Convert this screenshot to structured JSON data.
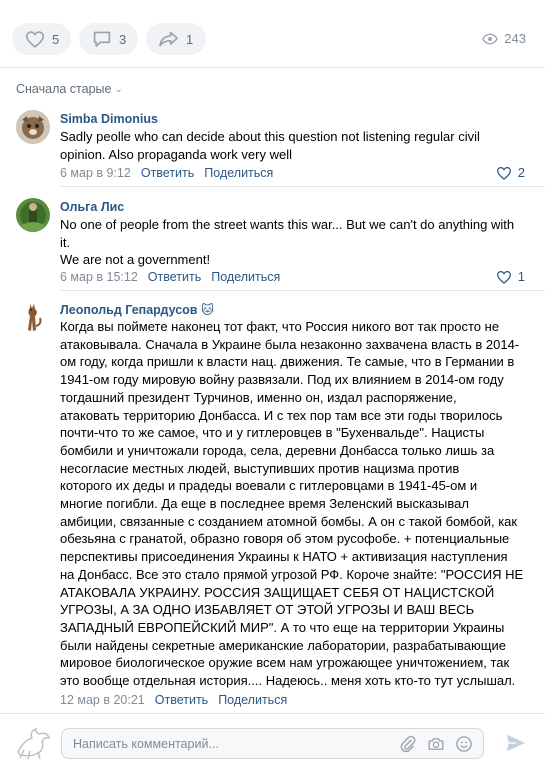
{
  "post_actions": {
    "likes": "5",
    "comments": "3",
    "shares": "1",
    "views": "243",
    "icons": {
      "like": "heart-icon",
      "comment": "comment-icon",
      "share": "share-icon",
      "views": "eye-icon"
    }
  },
  "sort": {
    "label": "Сначала старые",
    "icon": "chevron-down-icon"
  },
  "comments": [
    {
      "author": "Simba Dimonius",
      "lines": [
        "Sadly peolle who can decide about this question not listening regular civil",
        "opinion. Also propaganda work very well"
      ],
      "date": "6 мар в 9:12",
      "reply": "Ответить",
      "share": "Поделиться",
      "likes": "2"
    },
    {
      "author": "Ольга Лис",
      "lines": [
        "No one of people from the street wants this war... But we can't do anything with",
        "it.",
        "We are not a government!"
      ],
      "date": "6 мар в 15:12",
      "reply": "Ответить",
      "share": "Поделиться",
      "likes": "1"
    },
    {
      "author": "Леопольд Гепардусов",
      "badge": "🐱",
      "lines": [
        "Когда вы поймете наконец тот факт, что Россия никого вот так просто не",
        "атаковывала. Сначала в Украине была незаконно захвачена власть в 2014-",
        "ом году, когда пришли к власти нац. движения. Те самые, что в Германии в",
        "1941-ом году мировую войну развязали. Под их влиянием в 2014-ом году",
        "тогдашний президент Турчинов, именно он, издал распоряжение,",
        "атаковать территорию Донбасса. И с тех пор там все эти годы творилось",
        "почти-что то же самое, что и у гитлеровцев в \"Бухенвальде\". Нацисты",
        "бомбили и уничтожали города, села, деревни Донбасса только лишь за",
        "несогласие местных людей, выступивших против нацизма против",
        "которого их деды и прадеды воевали с гитлеровцами в 1941-45-ом и",
        "многие погибли. Да еще в последнее время Зеленский высказывал",
        "амбиции, связанные с созданием атомной бомбы. А он с такой бомбой, как",
        "обезьяна с гранатой, образно говоря об этом русофобе. + потенциальные",
        "перспективы присоединения Украины к НАТО + активизация наступления",
        "на Донбасс. Все это стало прямой угрозой РФ. Короче знайте: \"РОССИЯ НЕ",
        "АТАКОВАЛА УКРАИНУ. РОССИЯ ЗАЩИЩАЕТ СЕБЯ ОТ НАЦИСТСКОЙ",
        "УГРОЗЫ, А ЗА ОДНО ИЗБАВЛЯЕТ ОТ ЭТОЙ УГРОЗЫ И ВАШ ВЕСЬ",
        "ЗАПАДНЫЙ ЕВРОПЕЙСКИЙ МИР\". А то что еще на территории Украины",
        "были найдены секретные американские лаборатории, разрабатывающие",
        "мировое биологическое оружие всем нам угрожающее уничтожением, так",
        "это вообще отдельная история.... Надеюсь.. меня хоть кто-то тут услышал."
      ],
      "date": "12 мар в 20:21",
      "reply": "Ответить",
      "share": "Поделиться"
    }
  ],
  "composer": {
    "placeholder": "Написать комментарий...",
    "icons": [
      "paperclip-icon",
      "camera-icon",
      "emoji-icon",
      "send-icon"
    ]
  },
  "colors": {
    "link": "#2a5885",
    "muted": "#818c99",
    "pill_bg": "#f0f2f5",
    "divider": "#e7e8ec"
  }
}
